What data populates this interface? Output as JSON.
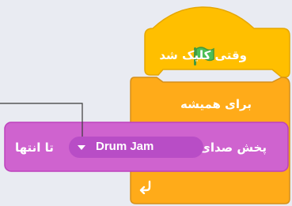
{
  "hat_block": {
    "label": "وقتی کلیک شد",
    "icon": "green-flag-icon",
    "color": "#ffbf00"
  },
  "forever_block": {
    "label": "برای همیشه",
    "icon": "repeat-arrow-icon",
    "color": "#ffab19"
  },
  "sound_block": {
    "label": "پخش صدای",
    "menu_value": "Drum Jam",
    "suffix": "تا انتها",
    "color": "#cf63cf",
    "menu_icon": "dropdown-caret-icon"
  }
}
